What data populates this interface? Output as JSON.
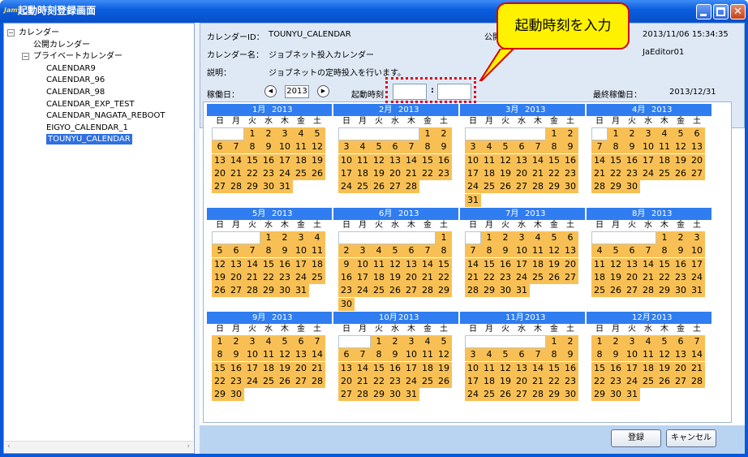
{
  "window": {
    "title": "起動時刻登録画面",
    "icon_text": "Jam"
  },
  "tree": {
    "items": [
      {
        "label": "カレンダー",
        "level": 0,
        "toggle": "⊟"
      },
      {
        "label": "公開カレンダー",
        "level": 1,
        "toggle": ""
      },
      {
        "label": "プライベートカレンダー",
        "level": 1,
        "toggle": "⊟"
      },
      {
        "label": "CALENDAR9",
        "level": 2,
        "toggle": ""
      },
      {
        "label": "CALENDAR_96",
        "level": 2,
        "toggle": ""
      },
      {
        "label": "CALENDAR_98",
        "level": 2,
        "toggle": ""
      },
      {
        "label": "CALENDAR_EXP_TEST",
        "level": 2,
        "toggle": ""
      },
      {
        "label": "CALENDAR_NAGATA_REBOOT",
        "level": 2,
        "toggle": ""
      },
      {
        "label": "EIGYO_CALENDAR_1",
        "level": 2,
        "toggle": ""
      },
      {
        "label": "TOUNYU_CALENDAR",
        "level": 2,
        "toggle": "",
        "selected": true
      }
    ]
  },
  "info": {
    "calendar_id_label": "カレンダーID：",
    "calendar_id": "TOUNYU_CALENDAR",
    "public_label": "公開",
    "datetime": "2013/11/06 15:34:35",
    "calendar_name_label": "カレンダー名：",
    "calendar_name": "ジョブネット投入カレンダー",
    "editor": "JaEditor01",
    "desc_label": "説明：",
    "desc": "ジョブネットの定時投入を行います。",
    "operating_day_label": "稼働日：",
    "year": "2013",
    "start_time_label": "起動時刻",
    "time_sep": ":",
    "last_day_label": "最終稼働日：",
    "last_day": "2013/12/31"
  },
  "callout": {
    "text": "起動時刻を入力"
  },
  "calendar": {
    "year": "2013",
    "weekdays": [
      "日",
      "月",
      "火",
      "水",
      "木",
      "金",
      "土"
    ],
    "months": [
      {
        "name": "1月",
        "first": 2,
        "days": 31
      },
      {
        "name": "2月",
        "first": 5,
        "days": 28
      },
      {
        "name": "3月",
        "first": 5,
        "days": 31
      },
      {
        "name": "4月",
        "first": 1,
        "days": 30
      },
      {
        "name": "5月",
        "first": 3,
        "days": 31
      },
      {
        "name": "6月",
        "first": 6,
        "days": 30
      },
      {
        "name": "7月",
        "first": 1,
        "days": 31
      },
      {
        "name": "8月",
        "first": 4,
        "days": 31
      },
      {
        "name": "9月",
        "first": 0,
        "days": 30
      },
      {
        "name": "10月",
        "first": 2,
        "days": 31
      },
      {
        "name": "11月",
        "first": 5,
        "days": 30
      },
      {
        "name": "12月",
        "first": 0,
        "days": 31
      }
    ]
  },
  "buttons": {
    "register": "登録",
    "cancel": "キャンセル"
  },
  "colors": {
    "title_bar": "#0a5cde",
    "month_header": "#2f7df0",
    "day_cell": "#f8c054",
    "callout_fill": "#fff200",
    "callout_border": "#d80000"
  }
}
